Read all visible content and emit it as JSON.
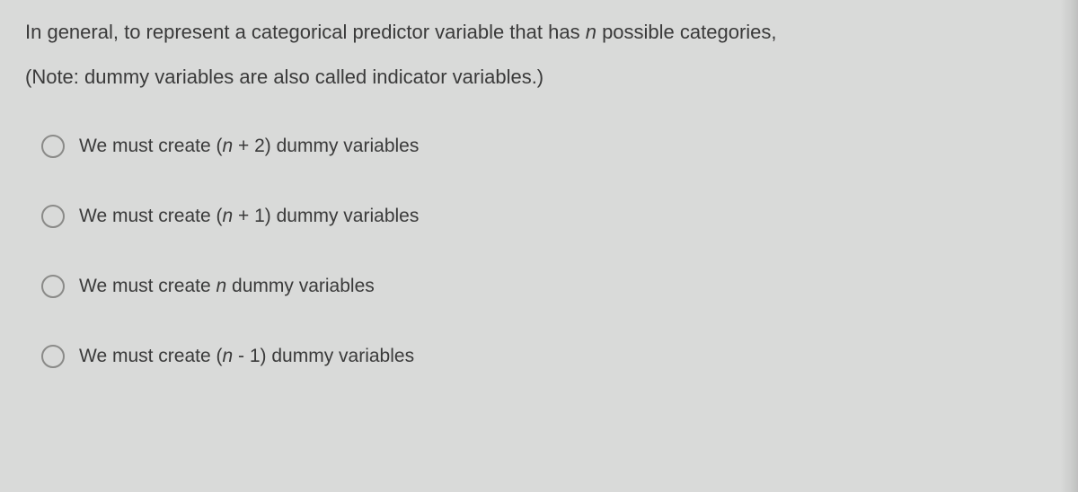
{
  "question": {
    "stem_prefix": "In general, to represent a categorical predictor variable that has ",
    "stem_var": "n",
    "stem_suffix": " possible categories,",
    "note": "(Note: dummy variables are also called indicator variables.)"
  },
  "options": [
    {
      "prefix": "We must create (",
      "var": "n",
      "suffix": " + 2) dummy variables"
    },
    {
      "prefix": "We must create (",
      "var": "n",
      "suffix": " + 1) dummy variables"
    },
    {
      "prefix": "We must create ",
      "var": "n",
      "suffix": " dummy variables"
    },
    {
      "prefix": "We must create (",
      "var": "n",
      "suffix": " - 1) dummy variables"
    }
  ]
}
